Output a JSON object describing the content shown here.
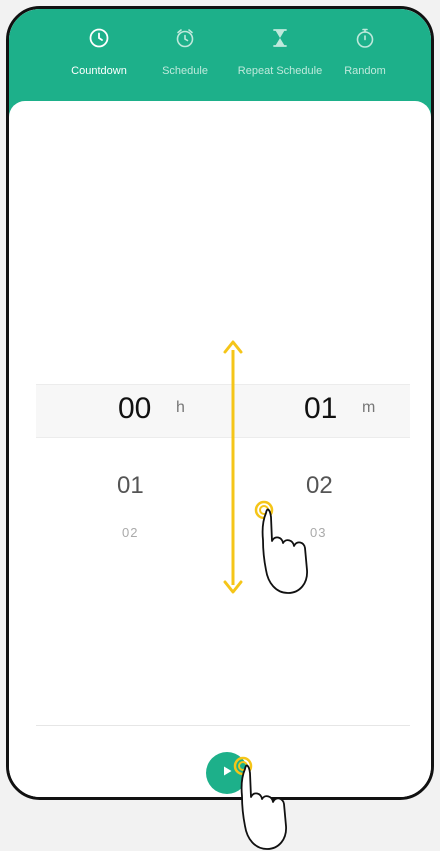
{
  "tabs": [
    {
      "label": "Countdown",
      "icon": "clock-icon",
      "active": true
    },
    {
      "label": "Schedule",
      "icon": "alarm-clock-icon",
      "active": false
    },
    {
      "label": "Repeat Schedule",
      "icon": "hourglass-icon",
      "active": false
    },
    {
      "label": "Random",
      "icon": "stopwatch-icon",
      "active": false
    }
  ],
  "picker": {
    "hours": {
      "selected": "00",
      "next": "01",
      "after": "02",
      "unit": "h"
    },
    "minutes": {
      "selected": "01",
      "next": "02",
      "after": "03",
      "unit": "m"
    }
  },
  "colors": {
    "accent": "#1db08a",
    "gesture": "#f5c518"
  },
  "gesture_hint": {
    "type": "vertical-swipe",
    "icon": "swipe-arrow-icon"
  },
  "play_button": {
    "icon": "play-icon"
  }
}
